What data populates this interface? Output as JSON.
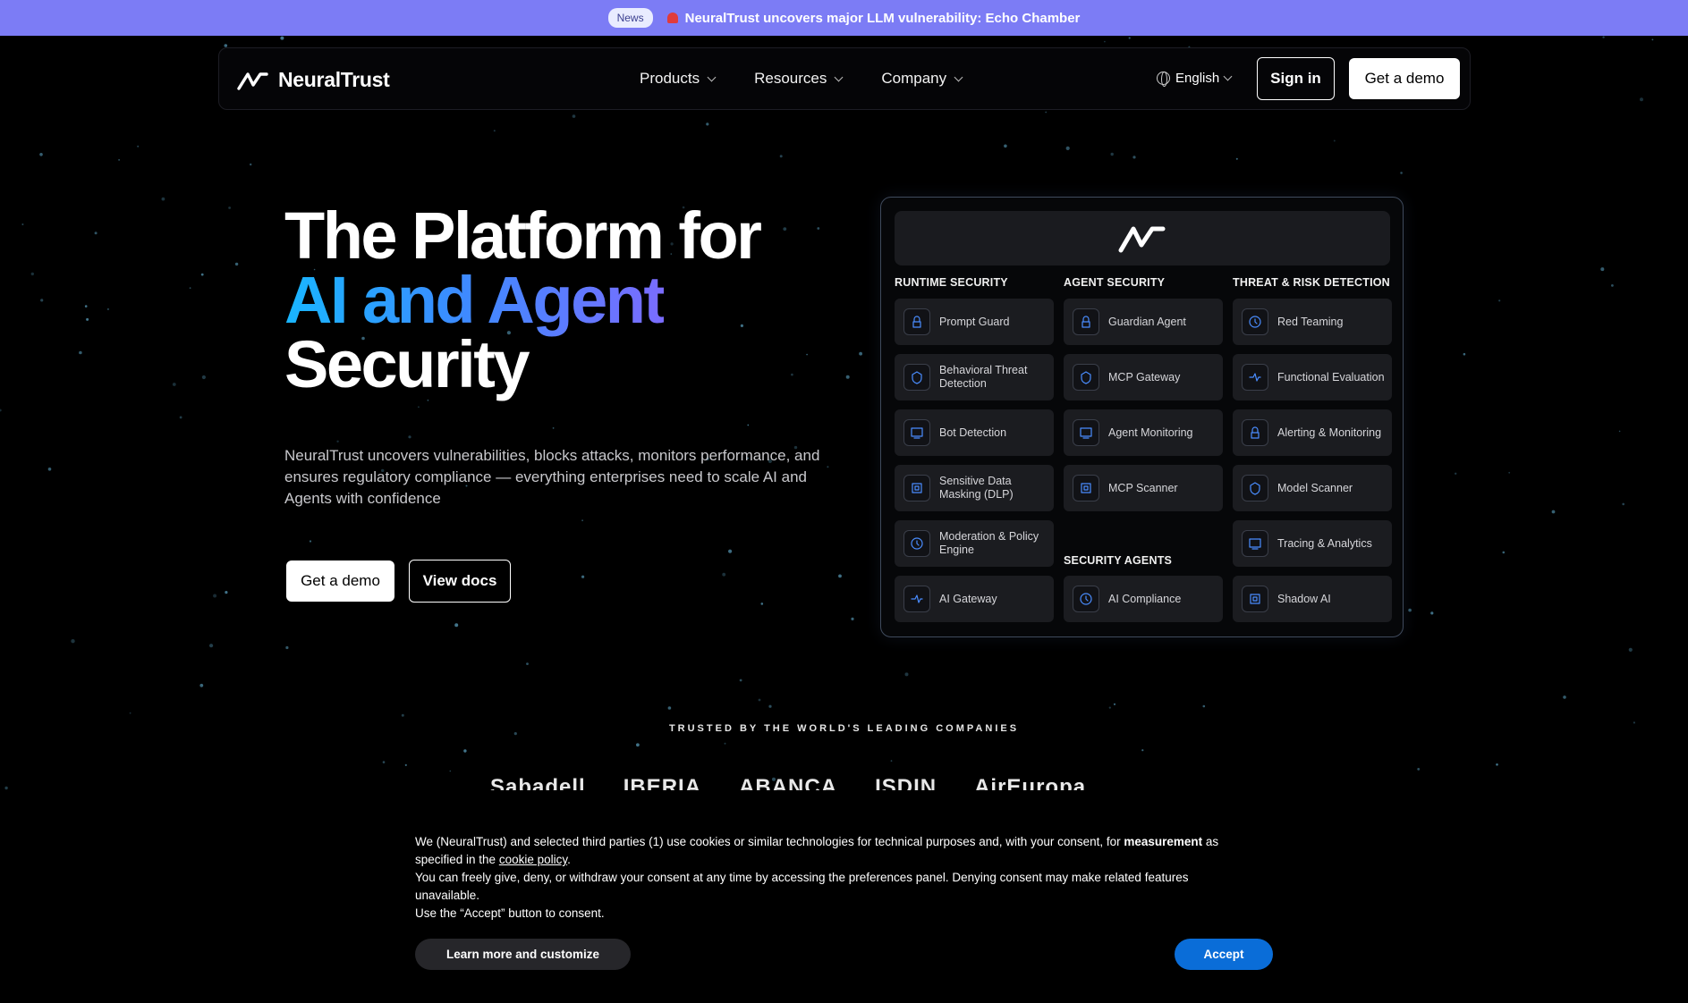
{
  "announcement": {
    "pill": "News",
    "text": "NeuralTrust uncovers major LLM vulnerability: Echo Chamber",
    "icon": "siren-icon"
  },
  "nav": {
    "brand": "NeuralTrust",
    "menu": [
      {
        "label": "Products"
      },
      {
        "label": "Resources"
      },
      {
        "label": "Company"
      }
    ],
    "language": "English",
    "sign_in": "Sign in",
    "demo": "Get a demo"
  },
  "hero": {
    "title_line1": "The Platform for",
    "title_line2": "AI and Agent",
    "title_line3": "Security",
    "description": "NeuralTrust uncovers vulnerabilities, blocks attacks, monitors performance, and ensures regulatory compliance — everything enterprises need to scale AI and Agents with confidence",
    "primary_button": "Get a demo",
    "secondary_button": "View docs"
  },
  "panel": {
    "columns": [
      {
        "title": "RUNTIME  SECURITY",
        "items": [
          "Prompt Guard",
          "Behavioral Threat Detection",
          "Bot Detection",
          "Sensitive Data Masking (DLP)",
          "Moderation & Policy Engine",
          "AI Gateway"
        ]
      },
      {
        "title": "AGENT SECURITY",
        "items": [
          "Guardian Agent",
          "MCP Gateway",
          "Agent Monitoring",
          "MCP Scanner"
        ]
      },
      {
        "title": "THREAT & RISK DETECTION",
        "items": [
          "Red Teaming",
          "Functional Evaluation",
          "Alerting & Monitoring",
          "Model Scanner",
          "Tracing & Analytics",
          "Shadow AI"
        ]
      }
    ],
    "security_agents": {
      "title": "SECURITY AGENTS",
      "items": [
        "AI Compliance"
      ]
    }
  },
  "trusted": {
    "heading": "TRUSTED BY THE WORLD'S LEADING COMPANIES",
    "logos": [
      "Sabadell",
      "IBERIA",
      "ABANCA",
      "ISDIN",
      "AirEuropa"
    ]
  },
  "cookie": {
    "line1_a": "We (NeuralTrust) and selected third parties (1) use cookies or similar technologies for technical purposes and, with your consent, for ",
    "line1_bold": "measurement",
    "line1_b": " as specified in the ",
    "link": "cookie policy",
    "line1_end": ".",
    "line2": "You can freely give, deny, or withdraw your consent at any time by accessing the preferences panel. Denying consent may make related features unavailable.",
    "line3": "Use the “Accept” button to consent.",
    "learn_more": "Learn more and customize",
    "accept": "Accept"
  },
  "colors": {
    "announcement_bg": "#7c7cf5",
    "accent_gradient_start": "#19b6ff",
    "accent_gradient_end": "#7a6cff",
    "accept_button": "#0a6dd8"
  }
}
